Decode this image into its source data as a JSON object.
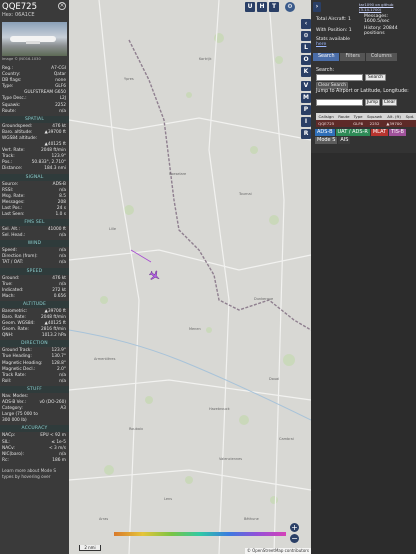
{
  "info": {
    "callsign": "QQE725",
    "hex": "Hex: 06A1CE",
    "photo_credit": "Image © JNO16-1030",
    "rows1": [
      {
        "k": "Reg.:",
        "v": "A7-CGI"
      },
      {
        "k": "Country:",
        "v": "Qatar"
      },
      {
        "k": "DB flags:",
        "v": "none"
      },
      {
        "k": "Type:",
        "v": "GLF6"
      },
      {
        "k": "",
        "v": "GULFSTREAM G650"
      },
      {
        "k": "Type Desc.:",
        "v": "L2J"
      },
      {
        "k": "Squawk:",
        "v": "2252"
      },
      {
        "k": "Route:",
        "v": "n/a"
      }
    ],
    "sections": [
      {
        "title": "SPATIAL",
        "rows": [
          {
            "k": "Groundspeed:",
            "v": "476 kt"
          },
          {
            "k": "Baro. altitude:",
            "v": "▲39700 ft"
          },
          {
            "k": "WGS84 altitude:",
            "v": ""
          },
          {
            "k": "",
            "v": "▲40125 ft"
          },
          {
            "k": "Vert. Rate:",
            "v": "2048 ft/min"
          },
          {
            "k": "Track:",
            "v": "123.9°"
          },
          {
            "k": "Pos.:",
            "v": "50.833°, 2.710°"
          },
          {
            "k": "Distance:",
            "v": "184.3 nmi"
          }
        ]
      },
      {
        "title": "SIGNAL",
        "rows": [
          {
            "k": "Source:",
            "v": "ADS-B"
          },
          {
            "k": "RSSI:",
            "v": "n/a"
          },
          {
            "k": "Msg. Rate:",
            "v": "8.5"
          },
          {
            "k": "Messages:",
            "v": "208"
          },
          {
            "k": "Last Pos.:",
            "v": "24 s"
          },
          {
            "k": "Last Seen:",
            "v": "1.0 s"
          }
        ]
      },
      {
        "title": "FMS SEL",
        "rows": [
          {
            "k": "Sel. Alt.:",
            "v": "41000 ft"
          },
          {
            "k": "Sel. Head.:",
            "v": "n/a"
          }
        ]
      },
      {
        "title": "WIND",
        "rows": [
          {
            "k": "Speed:",
            "v": "n/a"
          },
          {
            "k": "Direction (from):",
            "v": "n/a"
          },
          {
            "k": "TAT / OAT:",
            "v": "n/a"
          }
        ]
      },
      {
        "title": "SPEED",
        "rows": [
          {
            "k": "Ground:",
            "v": "476 kt"
          },
          {
            "k": "True:",
            "v": "n/a"
          },
          {
            "k": "Indicated:",
            "v": "272 kt"
          },
          {
            "k": "Mach:",
            "v": "0.656"
          }
        ]
      },
      {
        "title": "ALTITUDE",
        "rows": [
          {
            "k": "Barometric:",
            "v": "▲39700 ft"
          },
          {
            "k": "Baro. Rate:",
            "v": "2048 ft/min"
          },
          {
            "k": "Geom. WGS84:",
            "v": "▲40125 ft"
          },
          {
            "k": "Geom. Rate:",
            "v": "2816 ft/min"
          },
          {
            "k": "QNH:",
            "v": "1013.2 hPa"
          }
        ]
      },
      {
        "title": "DIRECTION",
        "rows": [
          {
            "k": "Ground Track:",
            "v": "123.9°"
          },
          {
            "k": "True Heading:",
            "v": "130.7°"
          },
          {
            "k": "Magnetic Heading:",
            "v": "128.8°"
          },
          {
            "k": "Magnetic Decl.:",
            "v": "2.0°"
          },
          {
            "k": "Track Rate:",
            "v": "n/a"
          },
          {
            "k": "Roll:",
            "v": "n/a"
          }
        ]
      },
      {
        "title": "STUFF",
        "rows": [
          {
            "k": "Nav. Modes:",
            "v": ""
          },
          {
            "k": "ADS-B Ver.:",
            "v": "v0 (DO-260)"
          },
          {
            "k": "Category:",
            "v": "A3"
          },
          {
            "k": "Large (75 000 to",
            "v": ""
          },
          {
            "k": "300 000 lb)",
            "v": ""
          }
        ]
      },
      {
        "title": "ACCURACY",
        "rows": [
          {
            "k": "NACp:",
            "v": "EPU < 92 m"
          },
          {
            "k": "SIL:",
            "v": "≤ 1e-5"
          },
          {
            "k": "NACv:",
            "v": "< 3 m/s"
          },
          {
            "k": "NIC(baro):",
            "v": "n/a"
          },
          {
            "k": "Rc:",
            "v": "186 m"
          }
        ]
      }
    ],
    "note": "Learn more about Mode S types by hovering over"
  },
  "map": {
    "buttons_top": [
      "U",
      "H",
      "T"
    ],
    "vbar_buttons": [
      "‹",
      "⊙",
      "L",
      "O",
      "K",
      "V",
      "M",
      "P",
      "I",
      "R"
    ],
    "zoom_in": "+",
    "zoom_out": "−",
    "scale": "2 nmi",
    "attribution": "© OpenStreetMap contributors",
    "towns": [
      {
        "n": "Ypres"
      },
      {
        "n": "Kortrijk"
      },
      {
        "n": "Roeselare"
      },
      {
        "n": "Lille"
      },
      {
        "n": "Tournai"
      },
      {
        "n": "Armentières"
      },
      {
        "n": "Menen"
      },
      {
        "n": "Dunkerque"
      },
      {
        "n": "Roubaix"
      },
      {
        "n": "Valenciennes"
      },
      {
        "n": "Douai"
      },
      {
        "n": "Lens"
      },
      {
        "n": "Béthune"
      },
      {
        "n": "Arras"
      },
      {
        "n": "Cambrai"
      },
      {
        "n": "Hazebrouck"
      }
    ]
  },
  "right": {
    "github_link": "tar1090 on github (3.14.1700)",
    "total_label": "Total Aircraft: 1",
    "withpos_label": "With Position: 1",
    "stats_label": "Stats available",
    "stats_link": "here",
    "messages_label": "Messages:",
    "messages_value": "1600.5/sec",
    "history_label": "History: 20844",
    "history_value": "positions",
    "tabs": [
      "Search",
      "Filters",
      "Columns"
    ],
    "search_label": "Search:",
    "search_button": "Search",
    "clear_search": "Clear Search",
    "jump_label": "Jump to Airport or Latitude, Longitude:",
    "jump_button": "Jump",
    "clear_button": "Clear",
    "table_headers": [
      "Callsign",
      "Route",
      "Type",
      "Squawk",
      "Alt. (ft)",
      "Spd."
    ],
    "table_row": [
      "QQE725",
      "",
      "GLF6",
      "2252",
      "▲39700",
      ""
    ],
    "tags": [
      {
        "t": "ADS-B",
        "c": "#2f6fb8"
      },
      {
        "t": "UAT / ADS-R",
        "c": "#2e8b57"
      },
      {
        "t": "MLAT",
        "c": "#b8342f"
      },
      {
        "t": "TIS-B",
        "c": "#a0529b"
      },
      {
        "t": "Mode S",
        "c": "#5c5c5c"
      },
      {
        "t": "AIS",
        "c": "#3d3d3d"
      }
    ]
  }
}
